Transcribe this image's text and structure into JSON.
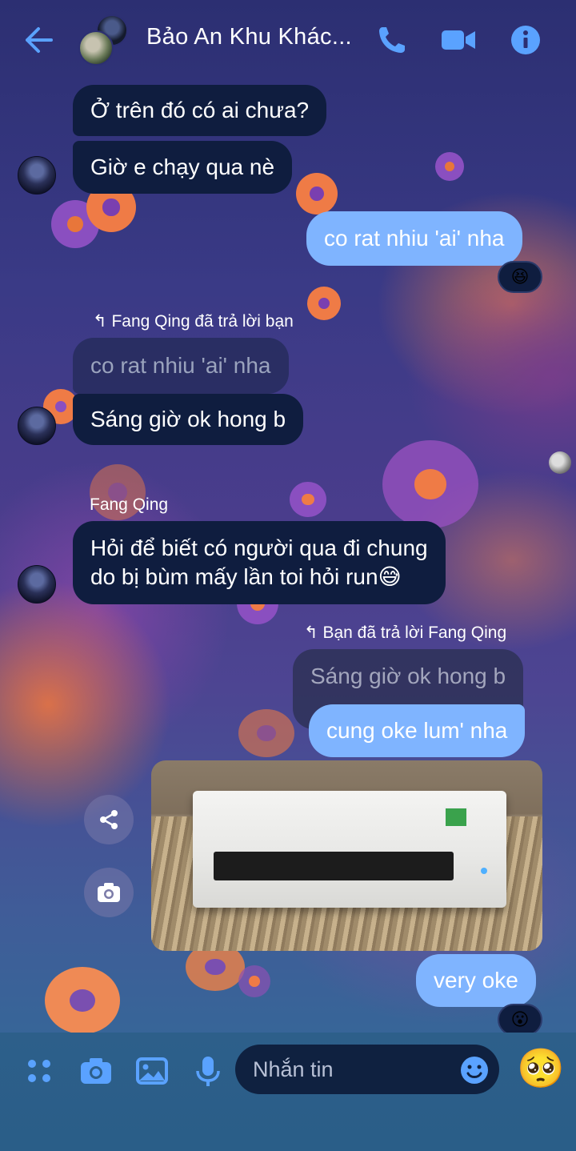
{
  "header": {
    "title": "Bảo An Khu Khác...",
    "icons": [
      "back-arrow-icon",
      "phone-icon",
      "video-camera-icon",
      "info-icon"
    ]
  },
  "messages": [
    {
      "side": "in",
      "text": "Ở trên đó có ai chưa?"
    },
    {
      "side": "in",
      "text": "Giờ e chạy qua nè"
    },
    {
      "side": "out",
      "text": "co rat nhiu 'ai' nha",
      "reaction": "😆"
    },
    {
      "side": "in",
      "reply_meta": "Fang Qing đã trả lời bạn",
      "quoted": "co rat nhiu 'ai' nha",
      "text": "Sáng giờ ok hong b"
    },
    {
      "side": "in",
      "sender": "Fang Qing",
      "text_line1": "Hỏi để biết có người qua đi chung",
      "text_line2": "do bị bùm mấy lần toi hỏi run😅"
    },
    {
      "side": "out",
      "reply_meta": "Bạn đã trả lời Fang Qing",
      "quoted": "Sáng giờ ok hong b",
      "text": "cung oke lum' nha"
    },
    {
      "side": "out",
      "type": "photo",
      "photo_icons": [
        "share-icon",
        "camera-icon"
      ]
    },
    {
      "side": "out",
      "text": "very oke",
      "reaction": "😮"
    }
  ],
  "composer": {
    "placeholder": "Nhắn tin",
    "icons": [
      "apps-icon",
      "camera-icon",
      "image-icon",
      "microphone-icon",
      "emoji-icon"
    ],
    "quick_emoji": "🥺"
  },
  "colors": {
    "accent": "#5aa2ff",
    "outgoing_bubble": "#7fb4ff",
    "incoming_bubble": "#0f1d3f"
  }
}
